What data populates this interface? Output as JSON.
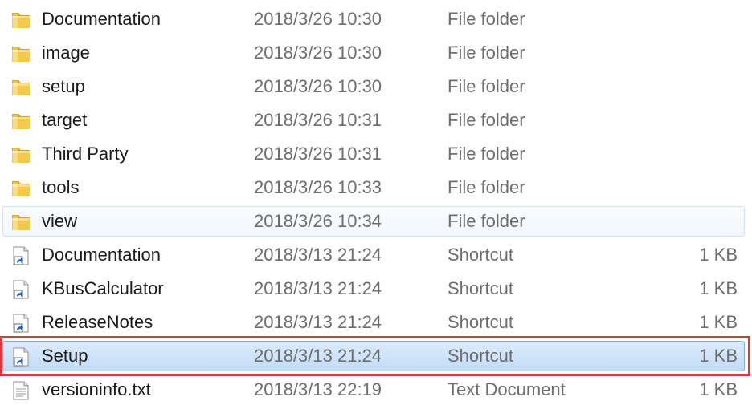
{
  "files": [
    {
      "name": "Documentation",
      "date": "2018/3/26 10:30",
      "type": "File folder",
      "size": "",
      "icon": "folder-icon"
    },
    {
      "name": "image",
      "date": "2018/3/26 10:30",
      "type": "File folder",
      "size": "",
      "icon": "folder-icon"
    },
    {
      "name": "setup",
      "date": "2018/3/26 10:30",
      "type": "File folder",
      "size": "",
      "icon": "folder-icon"
    },
    {
      "name": "target",
      "date": "2018/3/26 10:31",
      "type": "File folder",
      "size": "",
      "icon": "folder-icon"
    },
    {
      "name": "Third Party",
      "date": "2018/3/26 10:31",
      "type": "File folder",
      "size": "",
      "icon": "folder-icon"
    },
    {
      "name": "tools",
      "date": "2018/3/26 10:33",
      "type": "File folder",
      "size": "",
      "icon": "folder-icon"
    },
    {
      "name": "view",
      "date": "2018/3/26 10:34",
      "type": "File folder",
      "size": "",
      "icon": "folder-icon"
    },
    {
      "name": "Documentation",
      "date": "2018/3/13 21:24",
      "type": "Shortcut",
      "size": "1 KB",
      "icon": "shortcut-icon"
    },
    {
      "name": "KBusCalculator",
      "date": "2018/3/13 21:24",
      "type": "Shortcut",
      "size": "1 KB",
      "icon": "shortcut-icon"
    },
    {
      "name": "ReleaseNotes",
      "date": "2018/3/13 21:24",
      "type": "Shortcut",
      "size": "1 KB",
      "icon": "shortcut-icon"
    },
    {
      "name": "Setup",
      "date": "2018/3/13 21:24",
      "type": "Shortcut",
      "size": "1 KB",
      "icon": "shortcut-icon"
    },
    {
      "name": "versioninfo.txt",
      "date": "2018/3/13 22:19",
      "type": "Text Document",
      "size": "1 KB",
      "icon": "text-document-icon"
    }
  ],
  "state": {
    "hovered_row": "view",
    "selected_row": "Setup",
    "highlighted_row": "Setup"
  },
  "colors": {
    "highlight_border": "#e8323c",
    "selection_border": "#84acdd",
    "selection_fill": "#cde4fa",
    "folder_yellow": "#f2c94c",
    "shortcut_arrow": "#1f5fbf"
  }
}
